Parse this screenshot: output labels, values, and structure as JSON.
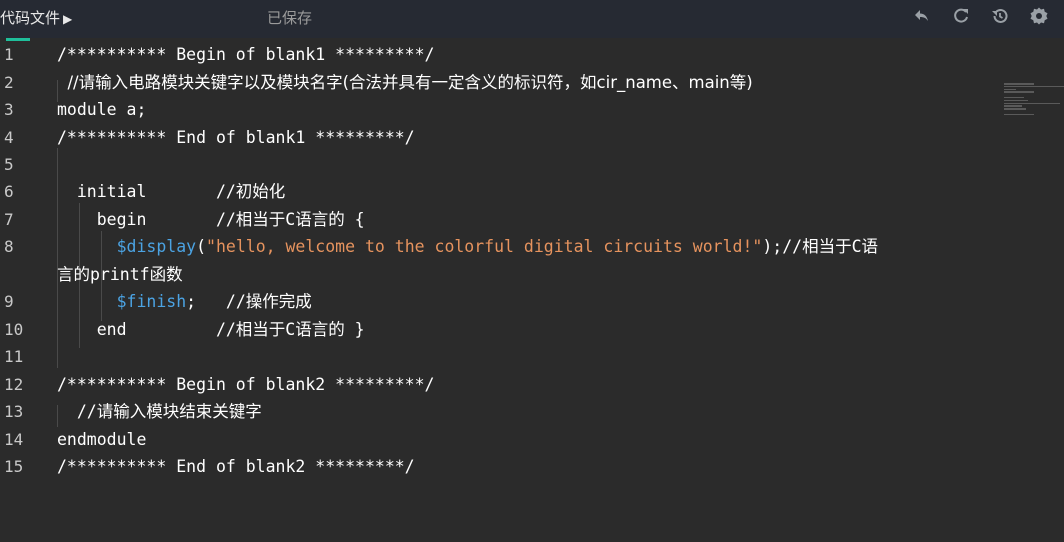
{
  "toolbar": {
    "file_label": "代码文件",
    "arrow": "▶",
    "save_status": "已保存",
    "icons": [
      "undo-icon",
      "refresh-icon",
      "restore-icon",
      "settings-icon"
    ]
  },
  "editor": {
    "line_numbers": [
      "1",
      "2",
      "3",
      "4",
      "5",
      "6",
      "7",
      "8",
      "9",
      "10",
      "11",
      "12",
      "13",
      "14",
      "15"
    ],
    "lines": [
      "/********** Begin of blank1 *********/",
      "  //请输入电路模块关键字以及模块名字(合法并具有一定含义的标识符，如cir_name、main等)",
      "module a;",
      "/********** End of blank1 *********/",
      "",
      "  initial       //初始化",
      "    begin       //相当于C语言的 {",
      [
        "      ",
        "$display",
        "(",
        "\"hello, welcome to the colorful digital circuits world!\"",
        ");//相当于C语"
      ],
      "言的printf函数",
      [
        "      ",
        "$finish",
        ";   //操作完成"
      ],
      "    end         //相当于C语言的 }",
      "",
      "/********** Begin of blank2 *********/",
      "  //请输入模块结束关键字",
      "endmodule",
      "/********** End of blank2 *********/"
    ]
  }
}
